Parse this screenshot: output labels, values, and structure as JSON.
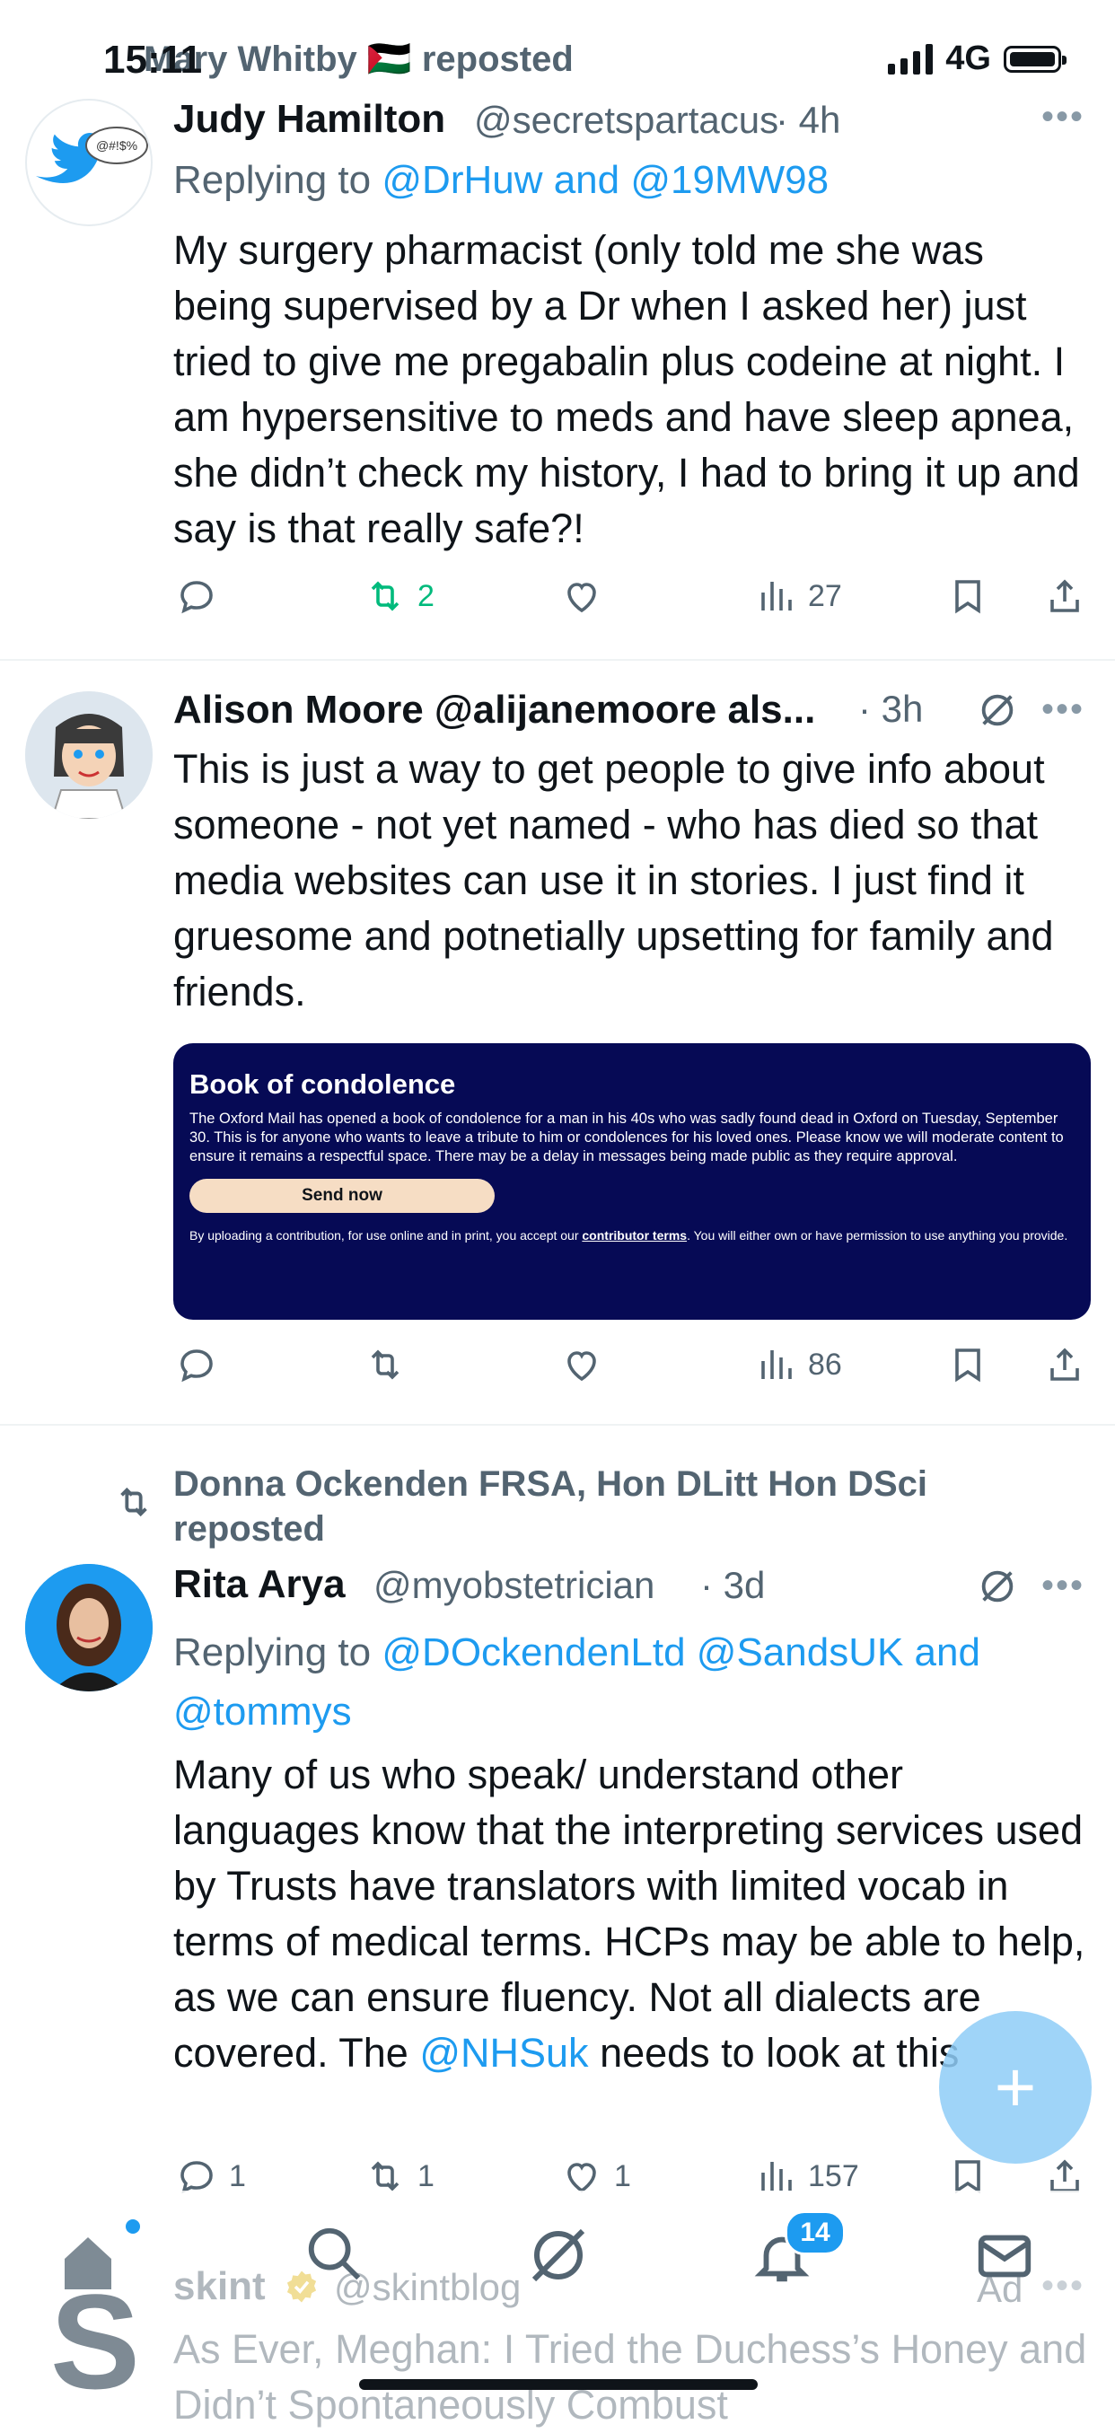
{
  "status_bar": {
    "time": "15:11",
    "network": "4G"
  },
  "tweet1": {
    "reposted_by": "Mary Whitby 🇵🇸 reposted",
    "name": "Judy Hamilton",
    "handle": "@secretspartacus",
    "time": "· 4h",
    "avatar_text": "@#!$%",
    "reply_prefix": "Replying to",
    "reply_to": "@DrHuw and @19MW98",
    "text": "My surgery pharmacist (only told me she was being supervised by a Dr when I asked her) just tried to give me pregabalin plus codeine at night. I am hypersensitive to meds and have sleep apnea, she didn’t check my history, I had to bring it up and say is that really safe?!",
    "retweets": "2",
    "views": "27"
  },
  "tweet2": {
    "name": "Alison Moore @alijanemoore als...",
    "time": "· 3h",
    "text": "This is just a way to get people to give info about someone - not yet named - who has died so that media websites can use it in stories. I just find it gruesome and potnetially upsetting for family and friends.",
    "card": {
      "title": "Book of condolence",
      "text": "The Oxford Mail has opened a book of condolence for a man in his 40s who was sadly found dead in Oxford on Tuesday, September 30. This is for anyone who wants to leave a tribute to him or condolences for his loved ones. Please know we will moderate content to ensure it remains a respectful space. There may be a delay in messages being made public as they require approval.",
      "button": "Send now",
      "fine_print_a": "By uploading a contribution, for use online and in print, you accept our ",
      "fine_print_link": "contributor terms",
      "fine_print_b": ". You will either own or have permission to use anything you provide."
    },
    "views": "86"
  },
  "tweet3": {
    "reposted_by": "Donna Ockenden FRSA, Hon DLitt Hon DSci reposted",
    "name": "Rita Arya",
    "handle": "@myobstetrician",
    "time": "· 3d",
    "reply_prefix": "Replying to",
    "reply_to_a": "@DOckendenLtd @SandsUK and",
    "reply_to_b": "@tommys",
    "text_a": "Many of us who speak/ understand other languages  know that the interpreting services used by Trusts have translators with limited vocab  in terms of medical terms. HCPs may be able to help,  as we can ensure fluency. Not all dialects are covered. The ",
    "text_link": "@NHSuk",
    "text_b": " needs to look at this",
    "replies": "1",
    "retweets": "1",
    "likes": "1",
    "views": "157"
  },
  "tweet4": {
    "name": "skint",
    "handle": "@skintblog",
    "ad_label": "Ad",
    "text": "As Ever, Meghan: I Tried the Duchess’s Honey and Didn’t Spontaneously Combust"
  },
  "nav": {
    "notifications_badge": "14"
  },
  "colors": {
    "accent": "#1d9bf0",
    "retweet_active": "#00ba7c",
    "card_bg": "#060a55"
  }
}
